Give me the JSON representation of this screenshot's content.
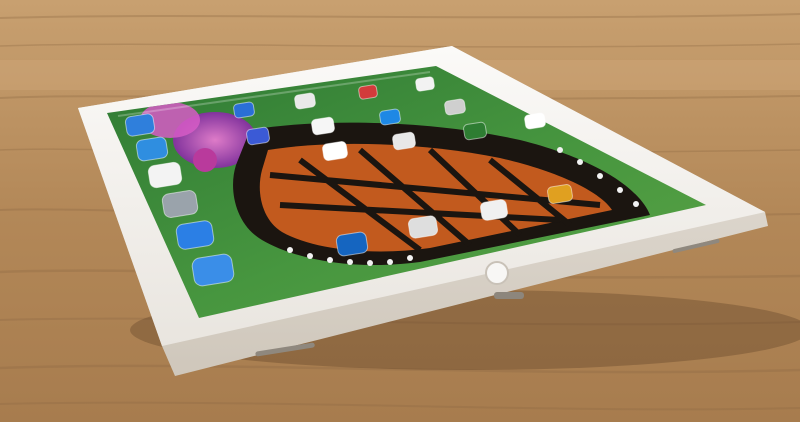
{
  "scene": {
    "subject": "tablet-on-wooden-table",
    "colors": {
      "wood_light": "#c49a6c",
      "wood_mid": "#ad8358",
      "wood_dark": "#8a6440",
      "bezel": "#f3f1ee",
      "screen_green": "#3f8f3a",
      "butterfly_orange": "#c25a1e",
      "butterfly_black": "#1b1510"
    }
  },
  "home_screen": {
    "dock_icons": [
      {
        "name": "mail-icon",
        "color": "#2f7fdc"
      },
      {
        "name": "safari-icon",
        "color": "#2f8ee0"
      },
      {
        "name": "photos-icon",
        "color": "#f3f3f3"
      },
      {
        "name": "settings-icon",
        "color": "#9aa3ab"
      },
      {
        "name": "dropbox-icon",
        "color": "#2b7fe5"
      },
      {
        "name": "keynote-icon",
        "color": "#3a8ee8"
      }
    ],
    "grid_icons": [
      {
        "name": "app-icon",
        "color": "#2a6fd6"
      },
      {
        "name": "app-icon",
        "color": "#e9e9e9"
      },
      {
        "name": "app-icon",
        "color": "#d23b3b"
      },
      {
        "name": "app-icon",
        "color": "#f2f2f2"
      },
      {
        "name": "app-icon",
        "color": "#3b5ad6"
      },
      {
        "name": "app-icon",
        "color": "#f6f6f6"
      },
      {
        "name": "app-icon",
        "color": "#1e88e5"
      },
      {
        "name": "app-icon",
        "color": "#cfcfcf"
      },
      {
        "name": "app-icon",
        "color": "#ffffff"
      },
      {
        "name": "app-icon",
        "color": "#e8e8e8"
      },
      {
        "name": "app-icon",
        "color": "#2e7d32"
      },
      {
        "name": "slack-icon",
        "color": "#ffffff"
      },
      {
        "name": "app-icon",
        "color": "#1565c0"
      },
      {
        "name": "app-icon",
        "color": "#dedede"
      },
      {
        "name": "app-icon",
        "color": "#f0f0f0"
      },
      {
        "name": "app-icon",
        "color": "#e0a020"
      }
    ]
  }
}
